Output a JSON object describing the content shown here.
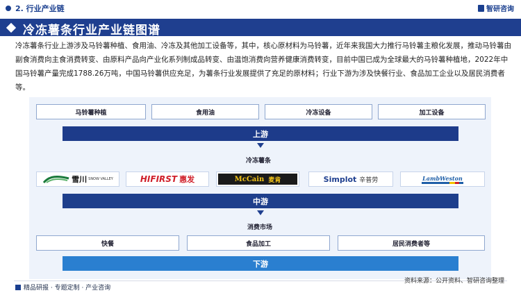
{
  "header": {
    "section_title": "2. 行业产业链",
    "brand": "智研咨询"
  },
  "title": "冷冻薯条行业产业链图谱",
  "description": "冷冻薯条行业上游涉及马铃薯种植、食用油、冷冻及其他加工设备等，其中，核心原材料为马铃薯，近年来我国大力推行马铃薯主粮化发展，推动马铃薯由副食消费向主食消费转变、由原料产品向产业化系列制成品转变、由温饱消费向营养健康消费转变，目前中国已成为全球最大的马铃薯种植地，2022年中国马铃薯产量完成1788.26万吨，中国马铃薯供应充足，为薯条行业发展提供了充足的原材料；行业下游为涉及快餐行业、食品加工企业以及居民消费者等。",
  "upstream": {
    "items": [
      "马铃薯种植",
      "食用油",
      "冷冻设备",
      "加工设备"
    ],
    "band_label": "上游"
  },
  "midstream": {
    "heading": "冷冻薯条",
    "logos": [
      {
        "name": "雪川",
        "sub": "SNOW VALLEY"
      },
      {
        "name": "HIFIRST",
        "sub": "惠发"
      },
      {
        "name": "McCain",
        "sub": "麦肯"
      },
      {
        "name": "Simplot",
        "sub": "辛普劳"
      },
      {
        "name": "LambWeston",
        "sub": ""
      }
    ],
    "band_label": "中游"
  },
  "downstream": {
    "heading": "消费市场",
    "items": [
      "快餐",
      "食品加工",
      "居民消费者等"
    ],
    "band_label": "下游"
  },
  "footer": {
    "left": "精品研报 · 专题定制 · 产业咨询",
    "source": "资料来源：公开资料、智研咨询整理"
  },
  "colors": {
    "primary": "#1f3f8f",
    "band_up": "#1d3b8a",
    "band_mid": "#1e3f8c",
    "band_down": "#2a7fd0"
  }
}
